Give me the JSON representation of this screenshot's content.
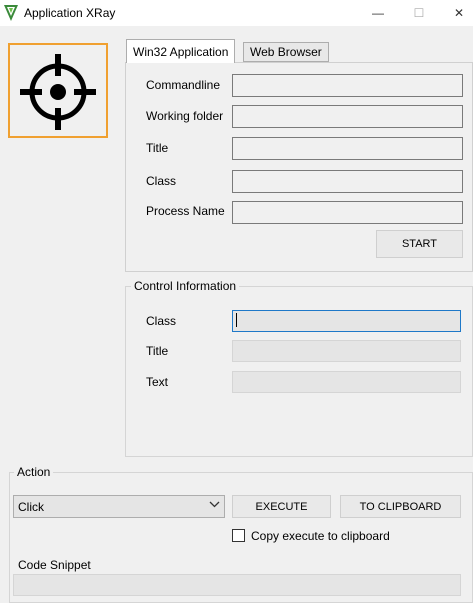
{
  "window": {
    "title": "Application XRay",
    "controls": {
      "minimize": "—",
      "maximize": "☐",
      "close": "✕"
    }
  },
  "finder": {
    "icon": "crosshair-icon",
    "accent_color": "#f0a030"
  },
  "tabs": [
    {
      "label": "Win32 Application",
      "active": true
    },
    {
      "label": "Web Browser",
      "active": false
    }
  ],
  "win32": {
    "fields": [
      {
        "label": "Commandline",
        "value": ""
      },
      {
        "label": "Working folder",
        "value": ""
      },
      {
        "label": "Title",
        "value": ""
      },
      {
        "label": "Class",
        "value": ""
      },
      {
        "label": "Process Name",
        "value": ""
      }
    ],
    "start_button": "START"
  },
  "control_info": {
    "title": "Control Information",
    "fields": [
      {
        "label": "Class",
        "value": ""
      },
      {
        "label": "Title",
        "value": ""
      },
      {
        "label": "Text",
        "value": ""
      }
    ]
  },
  "action": {
    "title": "Action",
    "selected": "Click",
    "execute_button": "EXECUTE",
    "clipboard_button": "TO CLIPBOARD",
    "checkbox_label": "Copy execute to clipboard",
    "checkbox_checked": false
  },
  "code_snippet": {
    "label": "Code Snippet",
    "value": ""
  }
}
